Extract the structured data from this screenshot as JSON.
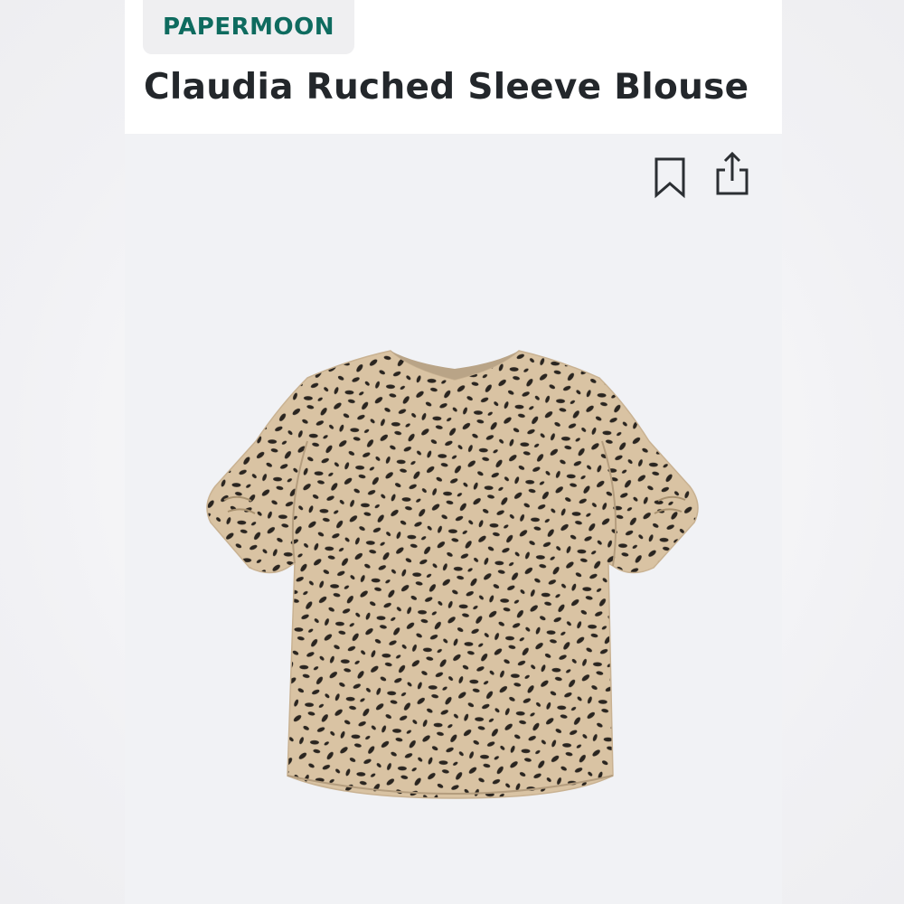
{
  "product": {
    "brand": "PAPERMOON",
    "title": "Claudia Ruched Sleeve Blouse"
  },
  "actions": {
    "bookmark_icon": "bookmark-icon",
    "share_icon": "share-icon"
  },
  "image": {
    "subject": "leopard print short-sleeve blouse",
    "colors": {
      "fabric": "#d9c3a3",
      "spots": "#2a2520"
    }
  },
  "colors": {
    "brand_text": "#0e6b5f",
    "brand_chip_bg": "#efeff1",
    "title_text": "#23272b",
    "image_bg": "#f1f2f5"
  }
}
